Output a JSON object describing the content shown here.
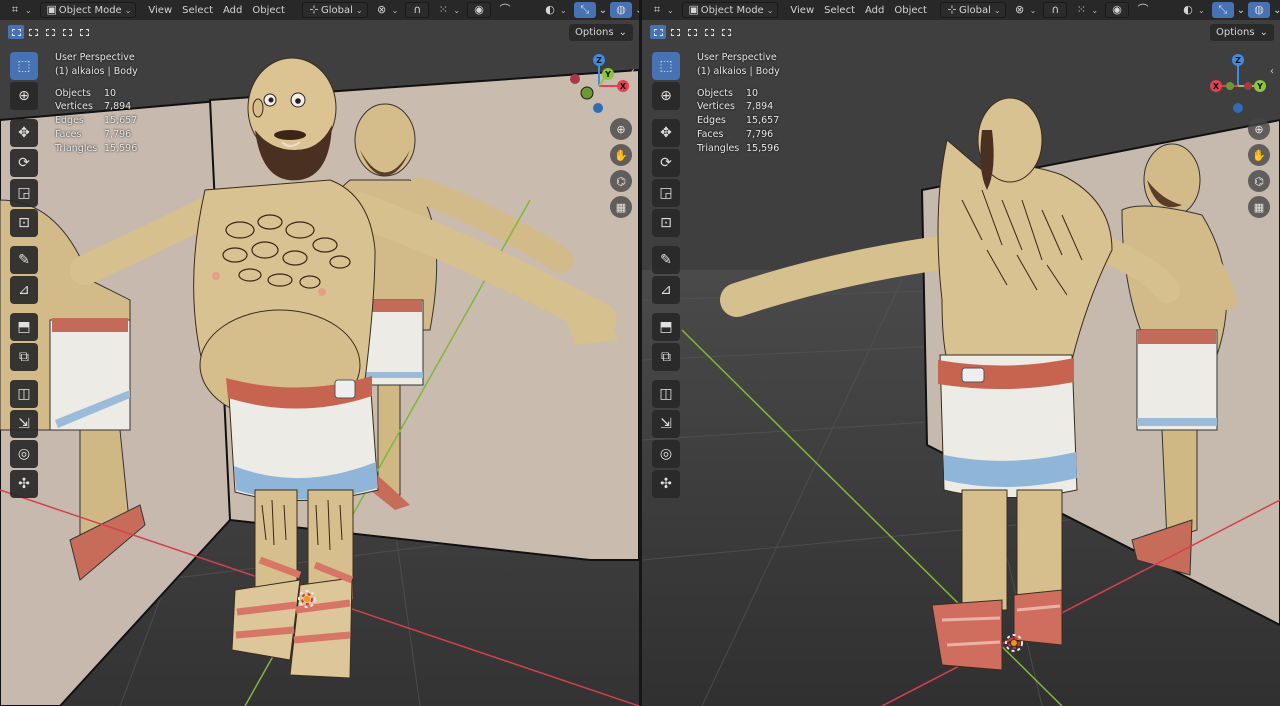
{
  "left": {
    "header": {
      "mode": "Object Mode",
      "menu": [
        "View",
        "Select",
        "Add",
        "Object"
      ],
      "orientation": "Global"
    },
    "options_label": "Options",
    "overlay": {
      "title": "User Perspective",
      "object": "(1) alkaios | Body",
      "stats": [
        {
          "label": "Objects",
          "value": "10"
        },
        {
          "label": "Vertices",
          "value": "7,894"
        },
        {
          "label": "Edges",
          "value": "15,657"
        },
        {
          "label": "Faces",
          "value": "7,796"
        },
        {
          "label": "Triangles",
          "value": "15,596"
        }
      ]
    },
    "gizmo": {
      "x": "X",
      "y": "Y",
      "z": "Z"
    }
  },
  "right": {
    "header": {
      "mode": "Object Mode",
      "menu": [
        "View",
        "Select",
        "Add",
        "Object"
      ],
      "orientation": "Global"
    },
    "options_label": "Options",
    "overlay": {
      "title": "User Perspective",
      "object": "(1) alkaios | Body",
      "stats": [
        {
          "label": "Objects",
          "value": "10"
        },
        {
          "label": "Vertices",
          "value": "7,894"
        },
        {
          "label": "Edges",
          "value": "15,657"
        },
        {
          "label": "Faces",
          "value": "7,796"
        },
        {
          "label": "Triangles",
          "value": "15,596"
        }
      ]
    },
    "gizmo": {
      "x": "X",
      "y": "Y",
      "z": "Z"
    }
  },
  "icons": {
    "editor_type": "viewport-editor-icon",
    "tools": [
      "select-box-icon",
      "cursor-icon",
      "move-icon",
      "rotate-icon",
      "scale-icon",
      "transform-icon",
      "annotate-icon",
      "measure-icon",
      "add-cube-icon",
      "add-object-icon",
      "bevel-icon",
      "extrude-icon",
      "spin-icon",
      "shrink-icon"
    ],
    "nav": [
      "zoom-icon",
      "hand-pan-icon",
      "camera-icon",
      "ortho-grid-icon"
    ]
  },
  "colors": {
    "accent": "#4772b3",
    "axis_x": "#e34050",
    "axis_y": "#8cc63f",
    "axis_z": "#3d8de0",
    "background": "#3d3d3d",
    "skin": "#d8c08c",
    "beard": "#4a3020",
    "tunic": "#e9e9e6",
    "tunic_stripe": "#8fb6d8",
    "belt": "#c66450",
    "sandal": "#d97a6c",
    "mirror_wall": "#c6b8ab"
  }
}
